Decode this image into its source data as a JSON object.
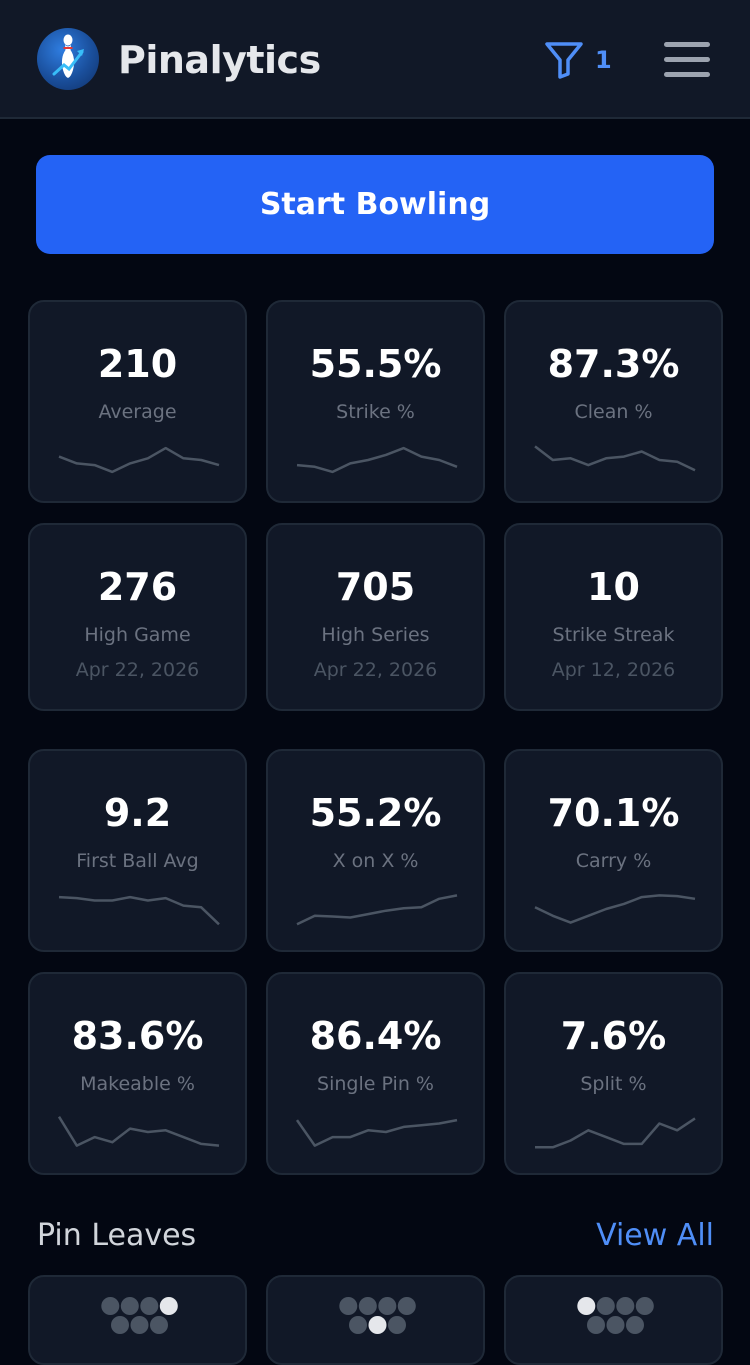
{
  "header": {
    "title": "Pinalytics",
    "logo_icon": "bowling-pin-logo-icon",
    "filter_icon": "filter-icon",
    "filter_count": "1",
    "menu_icon": "hamburger-menu-icon"
  },
  "start_button": {
    "label": "Start Bowling"
  },
  "stats": [
    {
      "value": "210",
      "label": "Average",
      "trend": [
        0.6,
        0.4,
        0.35,
        0.15,
        0.4,
        0.55,
        0.85,
        0.55,
        0.5,
        0.35
      ]
    },
    {
      "value": "55.5%",
      "label": "Strike %",
      "trend": [
        0.35,
        0.3,
        0.15,
        0.4,
        0.5,
        0.65,
        0.85,
        0.6,
        0.5,
        0.3
      ]
    },
    {
      "value": "87.3%",
      "label": "Clean %",
      "trend": [
        0.9,
        0.5,
        0.55,
        0.35,
        0.55,
        0.6,
        0.75,
        0.5,
        0.45,
        0.2
      ]
    }
  ],
  "records": [
    {
      "value": "276",
      "label": "High Game",
      "date": "Apr 22, 2026"
    },
    {
      "value": "705",
      "label": "High Series",
      "date": "Apr 22, 2026"
    },
    {
      "value": "10",
      "label": "Strike Streak",
      "date": "Apr 12, 2026"
    }
  ],
  "metrics": [
    {
      "value": "9.2",
      "label": "First Ball Avg",
      "trend": [
        0.85,
        0.82,
        0.75,
        0.75,
        0.85,
        0.75,
        0.82,
        0.6,
        0.55,
        0.05
      ]
    },
    {
      "value": "55.2%",
      "label": "X on X %",
      "trend": [
        0.05,
        0.3,
        0.28,
        0.25,
        0.35,
        0.45,
        0.52,
        0.55,
        0.8,
        0.9
      ]
    },
    {
      "value": "70.1%",
      "label": "Carry %",
      "trend": [
        0.55,
        0.3,
        0.1,
        0.3,
        0.5,
        0.65,
        0.85,
        0.9,
        0.88,
        0.8
      ]
    },
    {
      "value": "83.6%",
      "label": "Makeable %",
      "trend": [
        0.95,
        0.1,
        0.35,
        0.2,
        0.6,
        0.5,
        0.55,
        0.35,
        0.15,
        0.1
      ]
    },
    {
      "value": "86.4%",
      "label": "Single Pin %",
      "trend": [
        0.85,
        0.1,
        0.35,
        0.35,
        0.55,
        0.5,
        0.65,
        0.7,
        0.75,
        0.85
      ]
    },
    {
      "value": "7.6%",
      "label": "Split %",
      "trend": [
        0.05,
        0.05,
        0.25,
        0.55,
        0.35,
        0.15,
        0.15,
        0.75,
        0.55,
        0.9
      ]
    }
  ],
  "pin_leaves": {
    "title": "Pin Leaves",
    "view_all": "View All",
    "leaves": [
      {
        "standing": [
          10
        ]
      },
      {
        "standing": [
          5
        ]
      },
      {
        "standing": [
          7
        ]
      }
    ]
  },
  "colors": {
    "accent": "#2463f5",
    "link": "#4f8ef7",
    "card_bg": "#111827",
    "background": "#030712",
    "pin_standing": "#e5e7eb",
    "pin_down": "#4b5563",
    "sparkline": "#4b5563"
  }
}
